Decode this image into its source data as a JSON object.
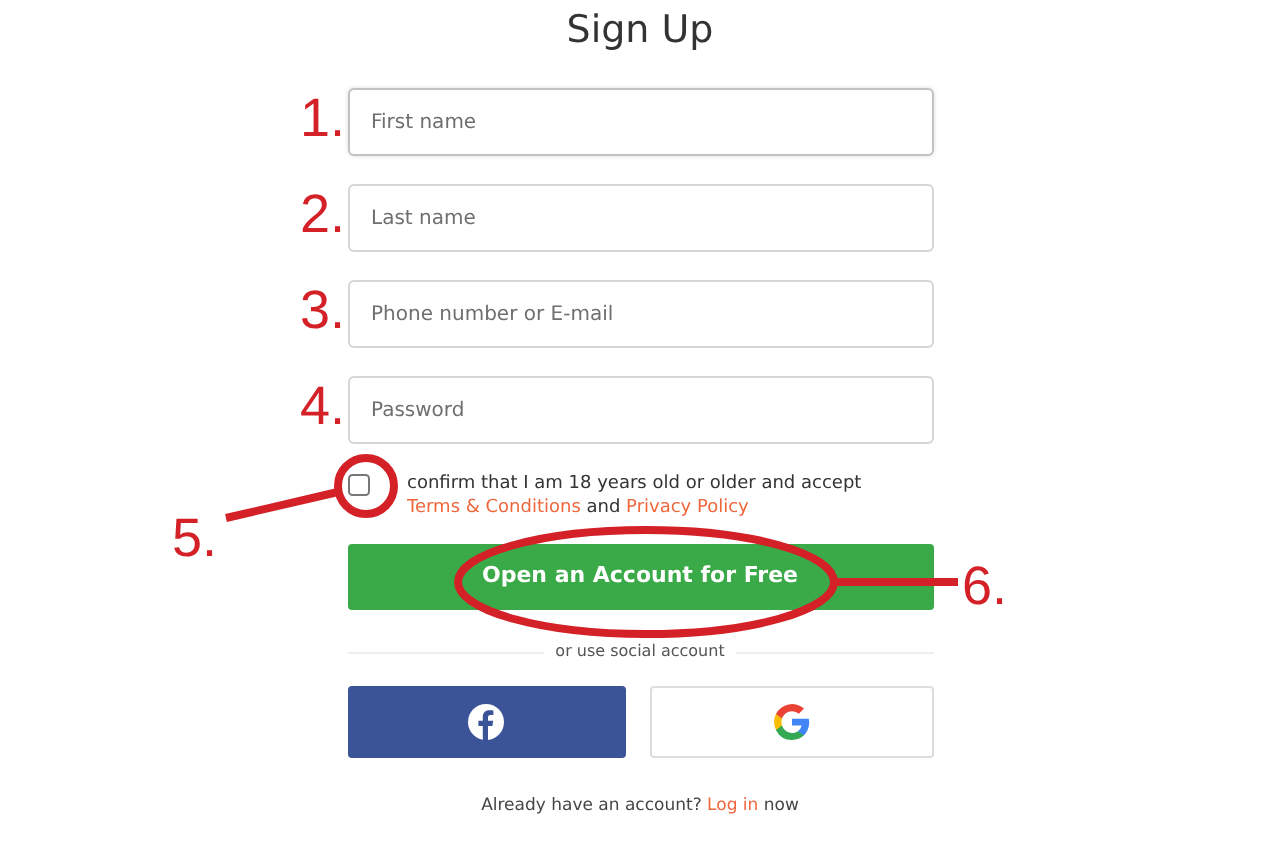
{
  "title": "Sign Up",
  "fields": [
    {
      "placeholder": "First name",
      "focused": true
    },
    {
      "placeholder": "Last name",
      "focused": false
    },
    {
      "placeholder": "Phone number or E-mail",
      "focused": false
    },
    {
      "placeholder": "Password",
      "focused": false
    }
  ],
  "consent": {
    "checked": false,
    "text": "confirm that I am 18 years old or older and accept",
    "terms_link": "Terms & Conditions",
    "joiner": "and",
    "privacy_link": "Privacy Policy"
  },
  "submit_button": "Open an Account for Free",
  "divider_text": "or use social account",
  "social_buttons": [
    {
      "kind": "facebook"
    },
    {
      "kind": "google"
    }
  ],
  "footer": {
    "text": "Already have an account?",
    "link": "Log in",
    "after": "now"
  },
  "annotations": [
    {
      "label": "1.",
      "kind": "number"
    },
    {
      "label": "2.",
      "kind": "number"
    },
    {
      "label": "3.",
      "kind": "number"
    },
    {
      "label": "4.",
      "kind": "number"
    },
    {
      "label": "5.",
      "kind": "circled"
    },
    {
      "label": "6.",
      "kind": "circled"
    }
  ]
}
